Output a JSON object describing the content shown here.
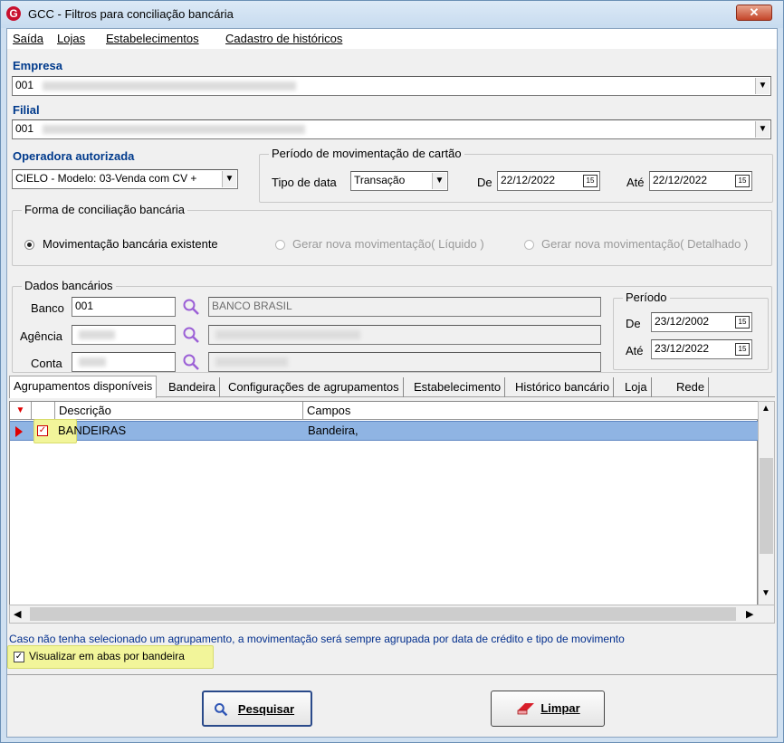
{
  "window": {
    "title": "GCC - Filtros para conciliação bancária",
    "app_icon": "G",
    "close_glyph": "✕"
  },
  "menu": [
    "Saída",
    "Lojas",
    "Estabelecimentos",
    "Cadastro de históricos"
  ],
  "empresa": {
    "label": "Empresa",
    "value": "001"
  },
  "filial": {
    "label": "Filial",
    "value": "001"
  },
  "operadora": {
    "label": "Operadora autorizada",
    "value": "CIELO - Modelo: 03-Venda com CV +"
  },
  "periodo_mov": {
    "title": "Período de movimentação de cartão",
    "tipo_label": "Tipo de data",
    "tipo_value": "Transação",
    "de_label": "De",
    "de_value": "22/12/2022",
    "ate_label": "Até",
    "ate_value": "22/12/2022"
  },
  "forma": {
    "title": "Forma de conciliação bancária",
    "options": [
      "Movimentação bancária existente",
      "Gerar nova movimentação( Líquido )",
      "Gerar nova movimentação( Detalhado )"
    ],
    "selected_index": 0
  },
  "dados": {
    "title": "Dados bancários",
    "banco_label": "Banco",
    "banco_value": "001",
    "banco_nome": "BANCO BRASIL",
    "agencia_label": "Agência",
    "conta_label": "Conta"
  },
  "periodo": {
    "title": "Período",
    "de_label": "De",
    "de_value": "23/12/2002",
    "ate_label": "Até",
    "ate_value": "23/12/2022"
  },
  "tabs": [
    "Agrupamentos disponíveis",
    "Bandeira",
    "Configurações de agrupamentos",
    "Estabelecimento",
    "Histórico bancário",
    "Loja",
    "Rede"
  ],
  "grid": {
    "headers": [
      "Descrição",
      "Campos"
    ],
    "rows": [
      {
        "checked": true,
        "descricao": "BANDEIRAS",
        "campos": "Bandeira,"
      }
    ]
  },
  "info_text": "Caso não tenha selecionado um agrupamento,  a movimentação será sempre agrupada por data de crédito e tipo de movimento",
  "visualizar": {
    "label": "Visualizar em abas por bandeira",
    "checked": true
  },
  "buttons": {
    "pesquisar": "Pesquisar",
    "limpar": "Limpar"
  },
  "colors": {
    "label_blue": "#003a8c",
    "row_select": "#8fb4e3",
    "highlight": "#f2f59a"
  }
}
